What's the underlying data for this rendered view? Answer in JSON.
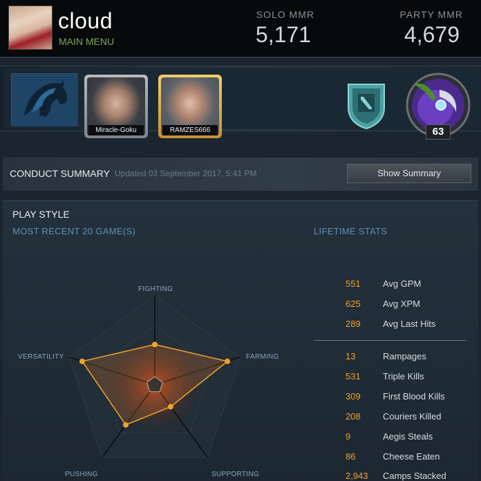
{
  "header": {
    "username": "cloud",
    "subtitle": "MAIN MENU",
    "solo_mmr_label": "SOLO MMR",
    "solo_mmr_value": "5,171",
    "party_mmr_label": "PARTY MMR",
    "party_mmr_value": "4,679"
  },
  "profile": {
    "team_logo_icon": "liquid-horse-logo",
    "favorite_players": [
      {
        "name": "Miracle-Goku",
        "frame": "silver"
      },
      {
        "name": "RAMZES666",
        "frame": "gold"
      }
    ],
    "rank_badge_icon": "dota-shield-icon",
    "level": "63"
  },
  "conduct": {
    "title": "CONDUCT SUMMARY",
    "updated": "Updated 03 September 2017, 5:41 PM",
    "button_label": "Show Summary"
  },
  "play_style": {
    "title": "PLAY STYLE",
    "recent_label": "MOST RECENT 20 GAME(S)",
    "lifetime_label": "LIFETIME STATS",
    "radar": {
      "axes": [
        "FIGHTING",
        "FARMING",
        "SUPPORTING",
        "PUSHING",
        "VERSATILITY"
      ],
      "values": [
        0.45,
        0.85,
        0.3,
        0.55,
        0.85
      ]
    }
  },
  "lifetime_stats": {
    "averages": [
      {
        "value": "551",
        "label": "Avg GPM"
      },
      {
        "value": "625",
        "label": "Avg XPM"
      },
      {
        "value": "289",
        "label": "Avg Last Hits"
      }
    ],
    "totals": [
      {
        "value": "13",
        "label": "Rampages"
      },
      {
        "value": "531",
        "label": "Triple Kills"
      },
      {
        "value": "309",
        "label": "First Blood Kills"
      },
      {
        "value": "208",
        "label": "Couriers Killed"
      },
      {
        "value": "9",
        "label": "Aegis Steals"
      },
      {
        "value": "86",
        "label": "Cheese Eaten"
      },
      {
        "value": "2,943",
        "label": "Camps Stacked"
      }
    ]
  },
  "colors": {
    "accent_orange": "#f0a22c",
    "accent_green": "#7eab52",
    "accent_blue_label": "#5f8fb3"
  }
}
